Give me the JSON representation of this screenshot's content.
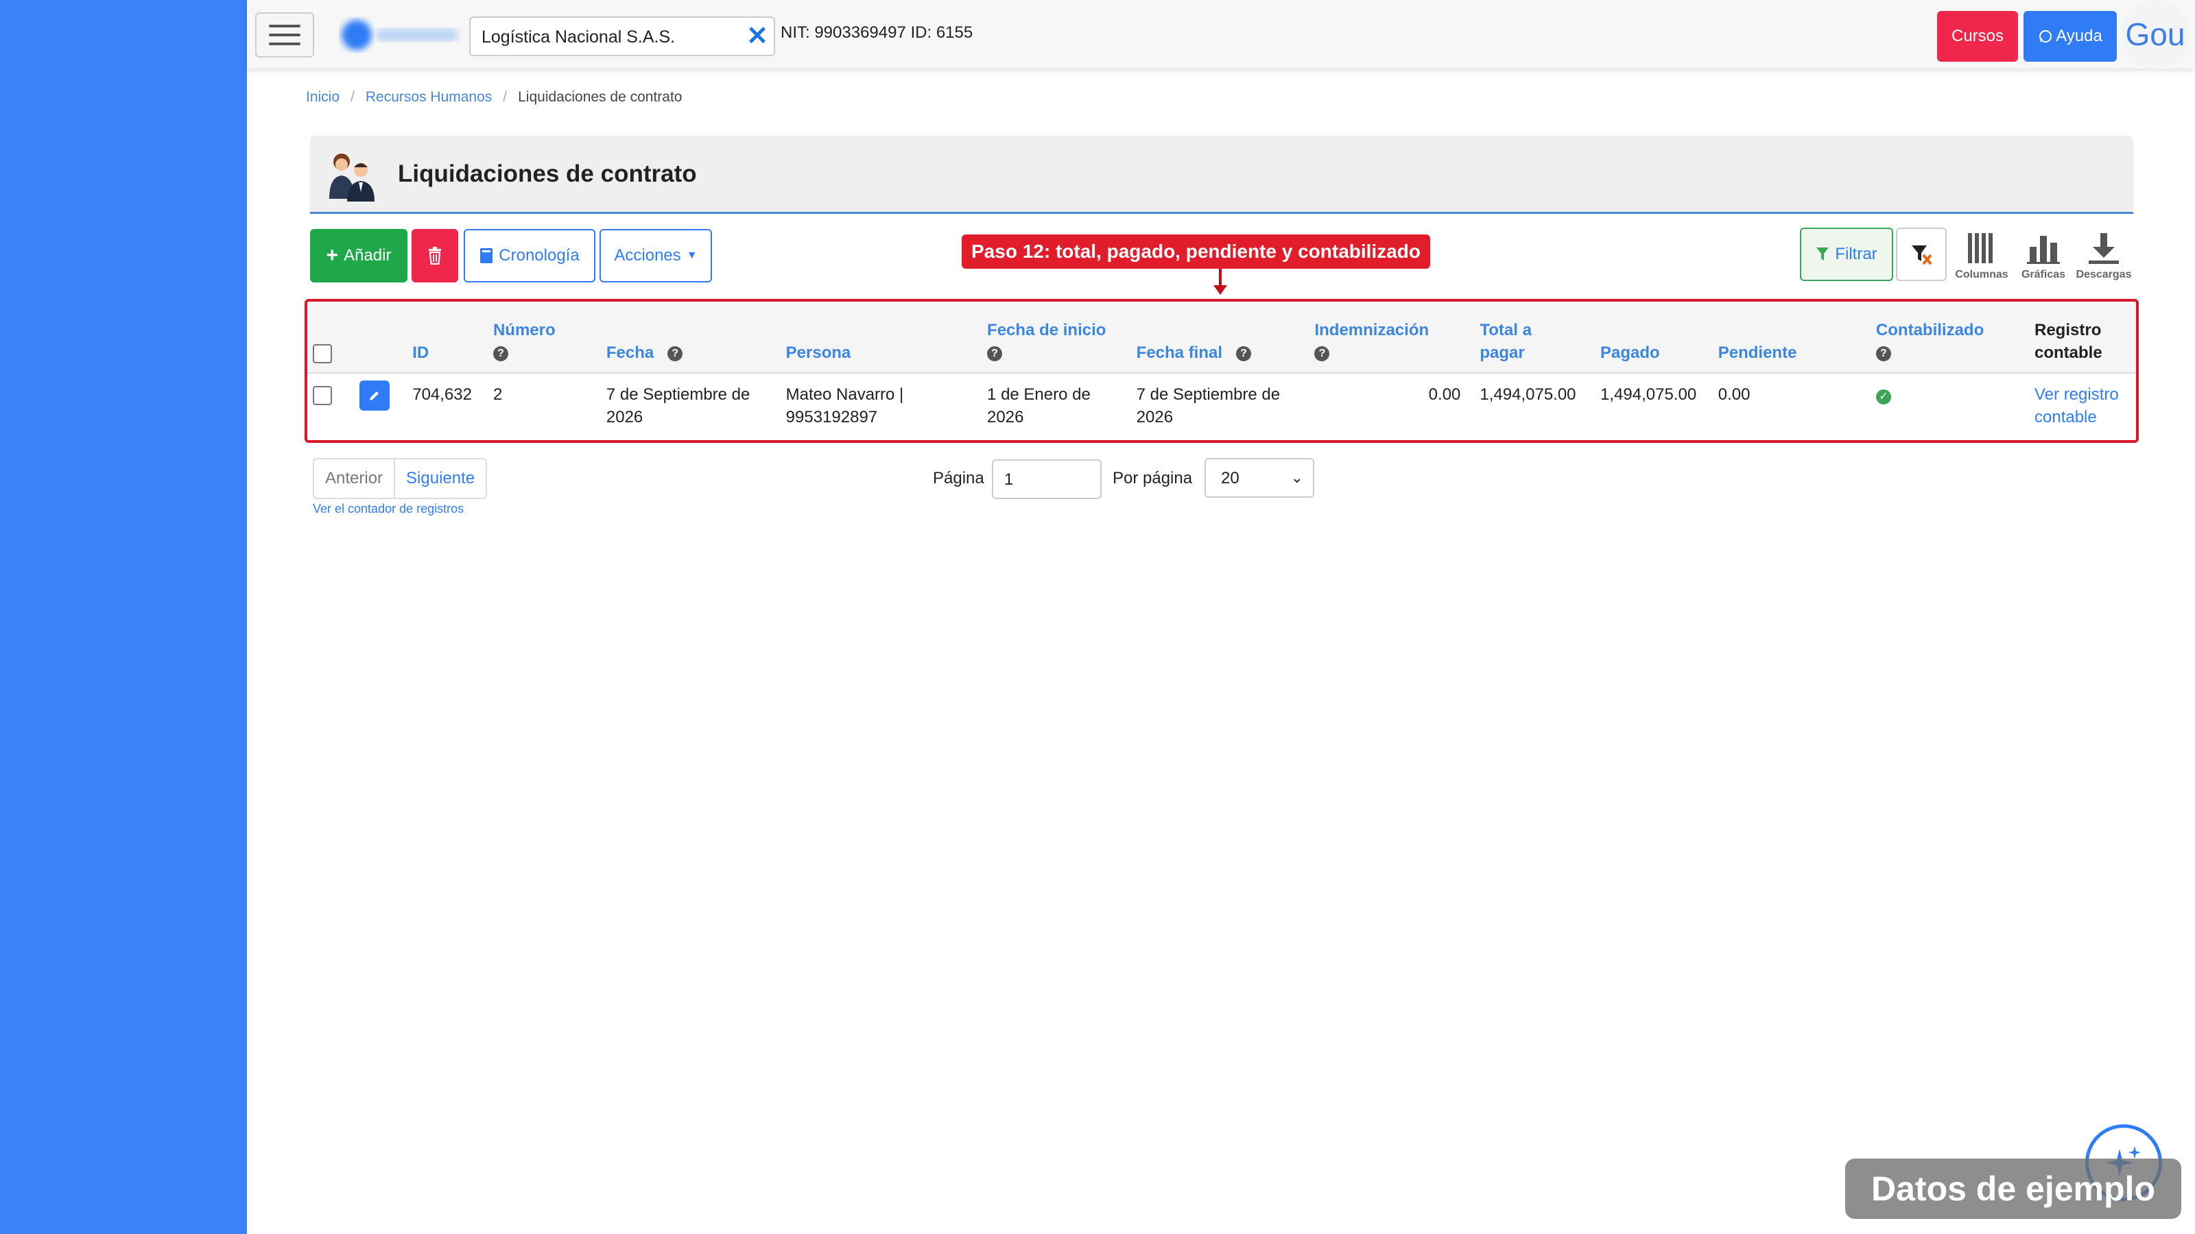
{
  "header": {
    "company_name": "Logística Nacional S.A.S.",
    "nit_id": "NIT: 9903369497 ID: 6155",
    "cursos_label": "Cursos",
    "ayuda_label": "Ayuda",
    "avatar_text": "Gou"
  },
  "breadcrumb": {
    "items": [
      "Inicio",
      "Recursos Humanos",
      "Liquidaciones de contrato"
    ],
    "separator": "/"
  },
  "page": {
    "title": "Liquidaciones de contrato"
  },
  "toolbar": {
    "add_label": "Añadir",
    "cronologia_label": "Cronología",
    "acciones_label": "Acciones",
    "filter_label": "Filtrar",
    "columnas_label": "Columnas",
    "graficas_label": "Gráficas",
    "descargas_label": "Descargas"
  },
  "tooltip": {
    "text": "Paso 12: total, pagado, pendiente y contabilizado"
  },
  "table": {
    "headers": {
      "id": "ID",
      "numero": "Número",
      "fecha": "Fecha",
      "persona": "Persona",
      "fecha_inicio": "Fecha de inicio",
      "fecha_final": "Fecha final",
      "indemnizacion": "Indemnización",
      "total": "Total a pagar",
      "pagado": "Pagado",
      "pendiente": "Pendiente",
      "contabilizado": "Contabilizado",
      "registro": "Registro contable"
    },
    "rows": [
      {
        "id": "704,632",
        "numero": "2",
        "fecha": "7 de Septiembre de 2026",
        "persona": "Mateo Navarro | 9953192897",
        "fecha_inicio": "1 de Enero de 2026",
        "fecha_final": "7 de Septiembre de 2026",
        "indemnizacion": "0.00",
        "total": "1,494,075.00",
        "pagado": "1,494,075.00",
        "pendiente": "0.00",
        "contabilizado": true,
        "registro_link": "Ver registro contable"
      }
    ]
  },
  "pagination": {
    "prev_label": "Anterior",
    "next_label": "Siguiente",
    "counter_link": "Ver el contador de registros",
    "page_label": "Página",
    "page_value": "1",
    "per_page_label": "Por página",
    "per_page_value": "20"
  },
  "watermark": {
    "text": "Datos de ejemplo"
  },
  "colors": {
    "sidebar": "#3b82f6",
    "primary": "#2f7cf6",
    "success": "#1fa84a",
    "danger": "#f0264a",
    "highlight": "#d8182a"
  }
}
